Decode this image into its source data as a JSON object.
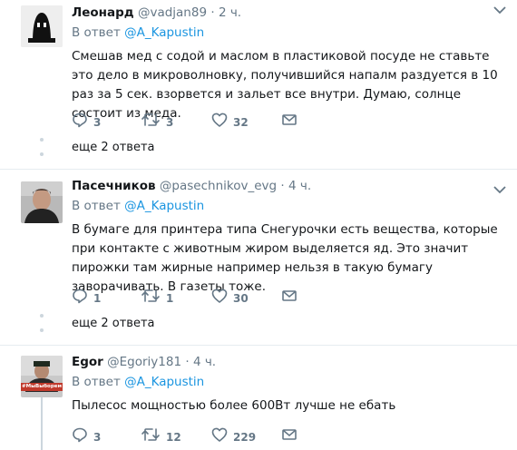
{
  "tweets": [
    {
      "name": "Леонард",
      "handle": "@vadjan89",
      "sep": "·",
      "time": "2 ч.",
      "reply_prefix": "В ответ",
      "reply_to": "@A_Kapustin",
      "text": "Смешав мед с содой и маслом в пластиковой посуде не ставьте это дело в микроволновку, получившийся напалм раздуется в 10 раз за 5 сек. взорвется и зальет все внутри. Думаю, солнце состоит из меда.",
      "replies": "3",
      "retweets": "3",
      "likes": "32",
      "more_replies": "еще 2 ответа"
    },
    {
      "name": "Пасечников",
      "handle": "@pasechnikov_evg",
      "sep": "·",
      "time": "4 ч.",
      "reply_prefix": "В ответ",
      "reply_to": "@A_Kapustin",
      "text": "В бумаге для принтера типа Снегурочки есть вещества, которые при контакте с животным жиром выделяется яд. Это значит пирожки там жирные например нельзя в такую бумагу заворачивать. В газеты тоже.",
      "replies": "1",
      "retweets": "1",
      "likes": "30",
      "more_replies": "еще 2 ответа"
    },
    {
      "name": "Egor",
      "handle": "@Egoriy181",
      "sep": "·",
      "time": "4 ч.",
      "reply_prefix": "В ответ",
      "reply_to": "@A_Kapustin",
      "text": "Пылесос мощностью более 600Вт лучше не ебать",
      "replies": "3",
      "retweets": "12",
      "likes": "229",
      "avatar_badge": "#МыВыборем"
    }
  ],
  "colors": {
    "link": "#1b95e0",
    "secondary": "#657786",
    "line": "#ccd6dd"
  },
  "icons": [
    "reply-icon",
    "retweet-icon",
    "like-icon",
    "message-icon",
    "chevron-down-icon"
  ]
}
